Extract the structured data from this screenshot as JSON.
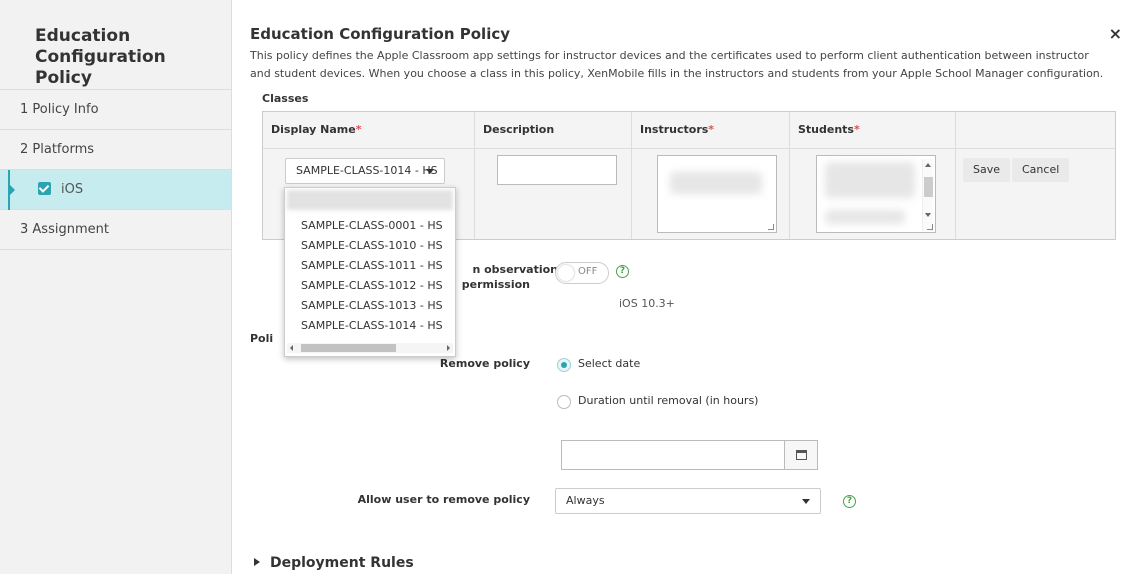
{
  "sidebar": {
    "title": "Education Configuration Policy",
    "items": [
      {
        "label": "1  Policy Info"
      },
      {
        "label": "2  Platforms"
      },
      {
        "label": "iOS"
      },
      {
        "label": "3  Assignment"
      }
    ]
  },
  "header": {
    "title": "Education Configuration Policy",
    "close": "×",
    "description": "This policy defines the Apple Classroom app settings for instructor devices and the certificates used to perform client authentication between instructor and student devices. When you choose a class in this policy, XenMobile fills in the instructors and students from your Apple School Manager configuration."
  },
  "classes": {
    "label": "Classes",
    "columns": {
      "display_name": "Display Name",
      "description": "Description",
      "instructors": "Instructors",
      "students": "Students",
      "required_mark": "*"
    },
    "selected_class": "SAMPLE-CLASS-1014 - HS",
    "save": "Save",
    "cancel": "Cancel",
    "dropdown_options": [
      "SAMPLE-CLASS-0001 - HS",
      "SAMPLE-CLASS-1010 - HS",
      "SAMPLE-CLASS-1011 - HS",
      "SAMPLE-CLASS-1012 - HS",
      "SAMPLE-CLASS-1013 - HS",
      "SAMPLE-CLASS-1014 - HS"
    ]
  },
  "observation": {
    "label_line1": "n observation",
    "label_line2": "permission",
    "toggle_text": "OFF",
    "help": "?",
    "note": "iOS 10.3+"
  },
  "policy_section_clipped": "Poli",
  "remove_policy": {
    "label": "Remove policy",
    "options": [
      "Select date",
      "Duration until removal (in hours)"
    ],
    "selected": "Select date"
  },
  "allow_remove": {
    "label": "Allow user to remove policy",
    "value": "Always",
    "help": "?"
  },
  "deployment_rules": "Deployment Rules",
  "colors": {
    "accent": "#2aa4b0",
    "active_bg": "#c6ecef",
    "required": "#d9534f",
    "help": "#4aa14a"
  }
}
